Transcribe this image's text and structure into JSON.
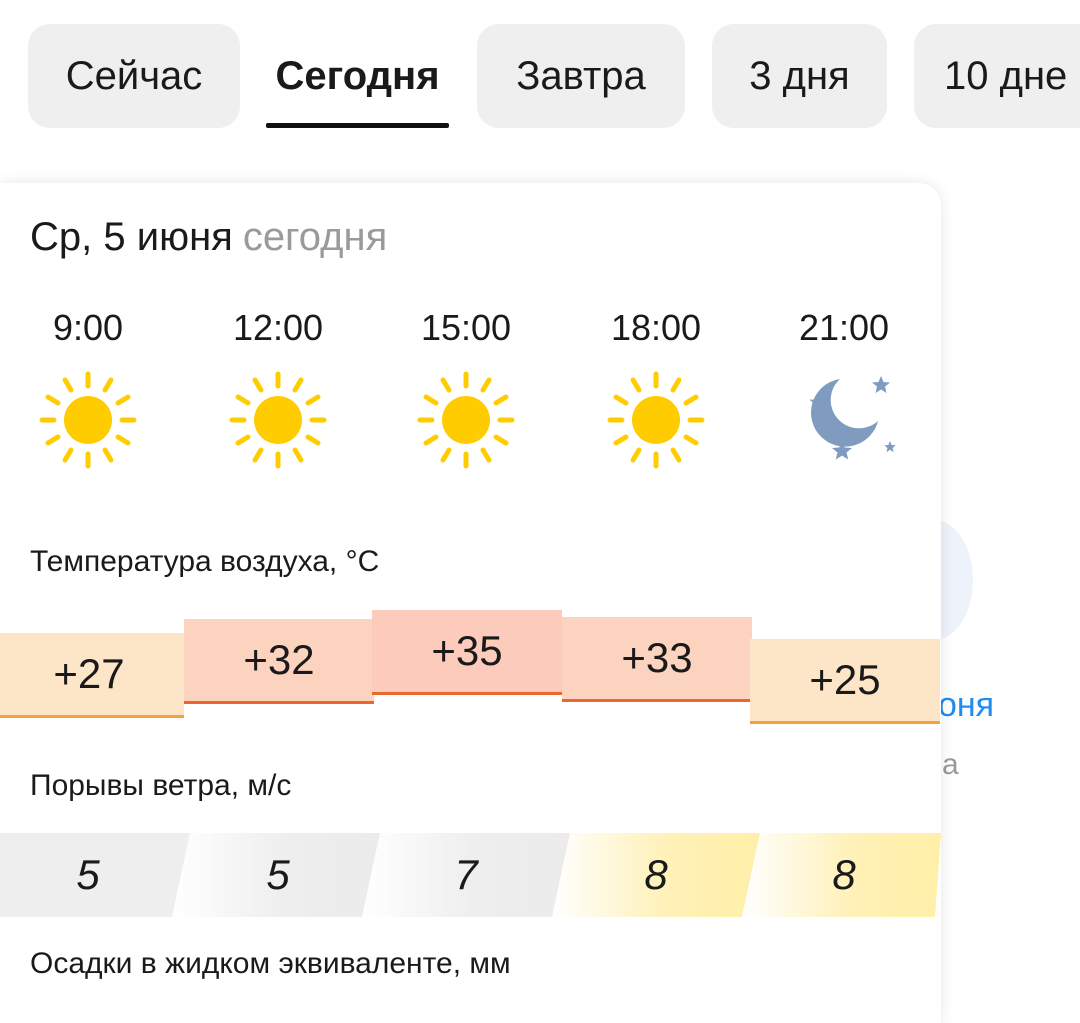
{
  "tabs": [
    {
      "label": "Сейчас",
      "active": false
    },
    {
      "label": "Сегодня",
      "active": true
    },
    {
      "label": "Завтра",
      "active": false
    },
    {
      "label": "3 дня",
      "active": false
    },
    {
      "label": "10 дне",
      "active": false
    }
  ],
  "background": {
    "link_fragment": "оня",
    "text_fragment": "а"
  },
  "day": {
    "date": "Ср, 5 июня",
    "relative": "сегодня"
  },
  "hours": [
    {
      "time": "9:00",
      "icon": "sun-icon"
    },
    {
      "time": "12:00",
      "icon": "sun-icon"
    },
    {
      "time": "15:00",
      "icon": "sun-icon"
    },
    {
      "time": "18:00",
      "icon": "sun-icon"
    },
    {
      "time": "21:00",
      "icon": "moon-stars-icon"
    }
  ],
  "temperature": {
    "label": "Температура воздуха, °C",
    "values": [
      "+27",
      "+32",
      "+35",
      "+33",
      "+25"
    ]
  },
  "wind": {
    "label": "Порывы ветра, м/с",
    "values": [
      "5",
      "5",
      "7",
      "8",
      "8"
    ]
  },
  "precip": {
    "label": "Осадки в жидком эквиваленте, мм"
  },
  "colors": {
    "sun": "#FFCC00",
    "moon": "#7F9BBF",
    "warm": "#FDE6C8",
    "hot": "#FCD3BE",
    "hotter": "#FCCBBB",
    "warm_line": "#F2A33A",
    "hot_line": "#E8682E",
    "wind_calm": "#EEEEEE",
    "wind_moderate": "#FFF1B8"
  }
}
